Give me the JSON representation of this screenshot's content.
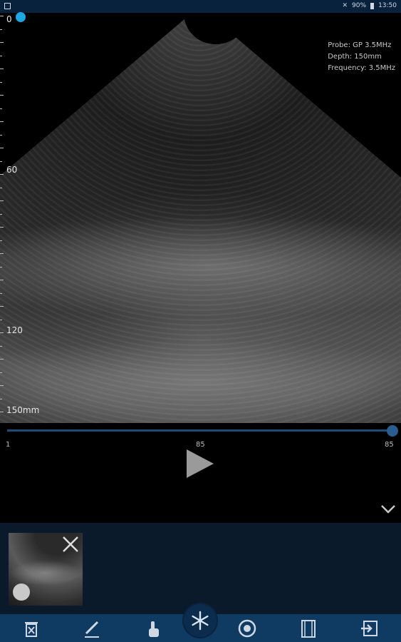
{
  "status_bar": {
    "battery": "90%",
    "time": "13:50"
  },
  "probe_info": {
    "probe": "Probe:  GP 3.5MHz",
    "depth": "Depth:  150mm",
    "frequency": "Frequency:  3.5MHz"
  },
  "depth_scale": {
    "top": "0",
    "mid1": "60",
    "mid2": "120",
    "bottom": "150mm"
  },
  "playback": {
    "start": "1",
    "current": "85",
    "end": "85",
    "position": 1.0
  },
  "toolbar": {
    "items": [
      "delete-icon",
      "edit-icon",
      "touch-icon",
      "freeze-icon",
      "capture-icon",
      "cine-icon",
      "exit-icon"
    ]
  },
  "colors": {
    "accent": "#1ea7e1",
    "toolbar": "#0f3a62",
    "strip": "#0a1a2b"
  }
}
